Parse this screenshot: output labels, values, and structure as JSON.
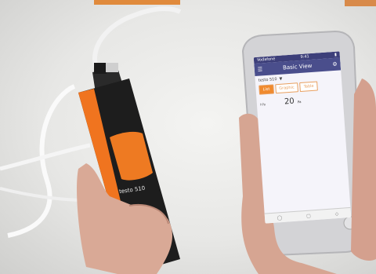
{
  "device": {
    "brand_label": "testo 510"
  },
  "app": {
    "status_left": "Vodafone",
    "status_time": "9:41",
    "title": "Basic View",
    "device_name": "testo 510",
    "tabs": [
      {
        "label": "List",
        "active": true
      },
      {
        "label": "Graphic",
        "active": false
      },
      {
        "label": "Table",
        "active": false
      }
    ],
    "reading_label": "hPa",
    "reading_value": "20",
    "reading_unit": "Pa"
  },
  "colors": {
    "accent": "#f08a2e",
    "navbar": "#4a4e8c",
    "device_body": "#1d1d1d"
  }
}
